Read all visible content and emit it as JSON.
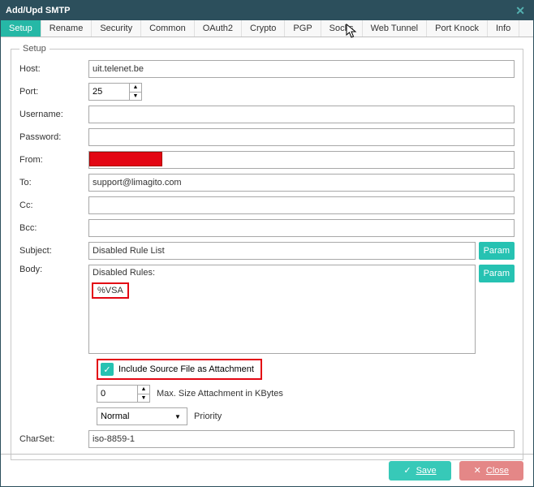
{
  "title": "Add/Upd SMTP",
  "tabs": [
    "Setup",
    "Rename",
    "Security",
    "Common",
    "OAuth2",
    "Crypto",
    "PGP",
    "Socks",
    "Web Tunnel",
    "Port Knock",
    "Info"
  ],
  "legend": "Setup",
  "labels": {
    "host": "Host:",
    "port": "Port:",
    "username": "Username:",
    "password": "Password:",
    "from": "From:",
    "to": "To:",
    "cc": "Cc:",
    "bcc": "Bcc:",
    "subject": "Subject:",
    "body": "Body:",
    "charset": "CharSet:",
    "include": "Include Source File as Attachment",
    "maxsize": "Max. Size Attachment in KBytes",
    "priority": "Priority"
  },
  "values": {
    "host": "uit.telenet.be",
    "port": "25",
    "username": "",
    "password": "",
    "from": "",
    "to": "support@limagito.com",
    "cc": "",
    "bcc": "",
    "subject": "Disabled Rule List",
    "bodytext": "Disabled Rules:",
    "vsa": "%VSA",
    "maxsize": "0",
    "priority": "Normal",
    "charset": "iso-8859-1"
  },
  "buttons": {
    "param": "Param",
    "save": "Save",
    "close": "Close"
  }
}
